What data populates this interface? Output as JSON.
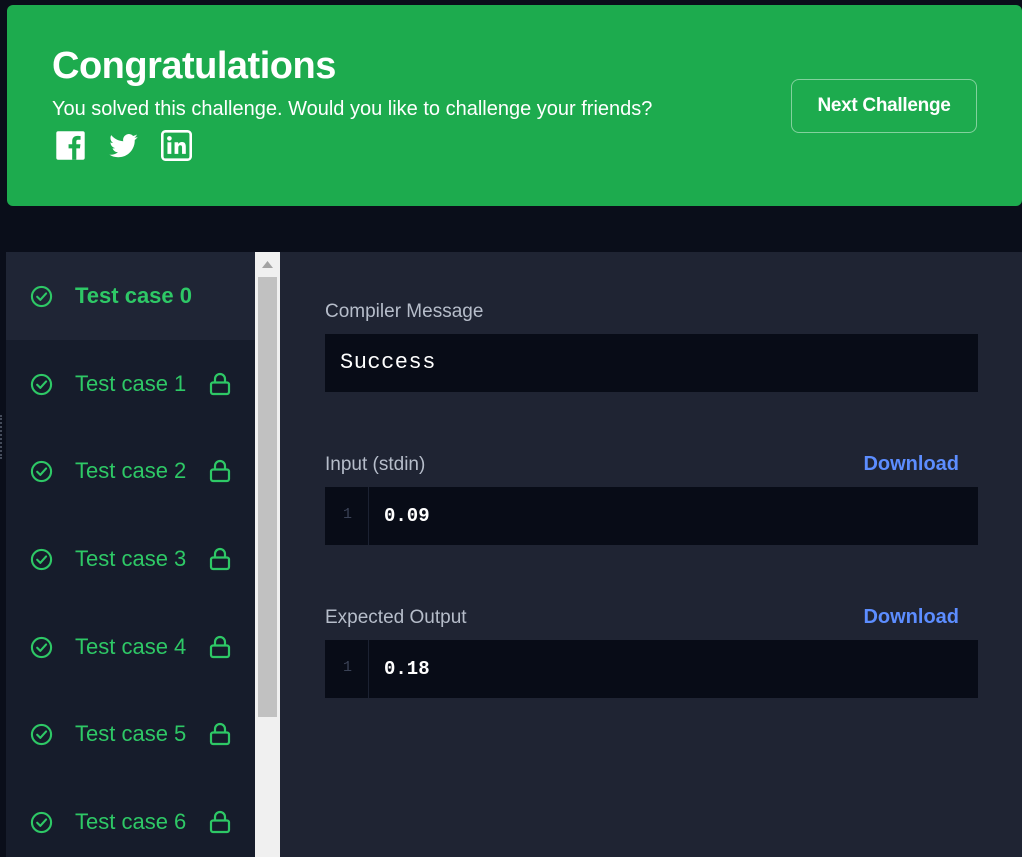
{
  "banner": {
    "title": "Congratulations",
    "subtitle": "You solved this challenge. Would you like to challenge your friends?",
    "next_button": "Next Challenge",
    "social_icons": [
      "facebook-icon",
      "twitter-icon",
      "linkedin-icon"
    ],
    "bg_color": "#1dab4e"
  },
  "test_cases": [
    {
      "label": "Test case 0",
      "passed": true,
      "locked": false,
      "active": true
    },
    {
      "label": "Test case 1",
      "passed": true,
      "locked": true,
      "active": false
    },
    {
      "label": "Test case 2",
      "passed": true,
      "locked": true,
      "active": false
    },
    {
      "label": "Test case 3",
      "passed": true,
      "locked": true,
      "active": false
    },
    {
      "label": "Test case 4",
      "passed": true,
      "locked": true,
      "active": false
    },
    {
      "label": "Test case 5",
      "passed": true,
      "locked": true,
      "active": false
    },
    {
      "label": "Test case 6",
      "passed": true,
      "locked": true,
      "active": false
    }
  ],
  "result": {
    "compiler_label": "Compiler Message",
    "compiler_message": "Success",
    "input_label": "Input (stdin)",
    "input_download": "Download",
    "input_line_number": "1",
    "input_value": "0.09",
    "output_label": "Expected Output",
    "output_download": "Download",
    "output_line_number": "1",
    "output_value": "0.18"
  },
  "colors": {
    "success_green": "#2ec866",
    "link_blue": "#5c8dff"
  }
}
